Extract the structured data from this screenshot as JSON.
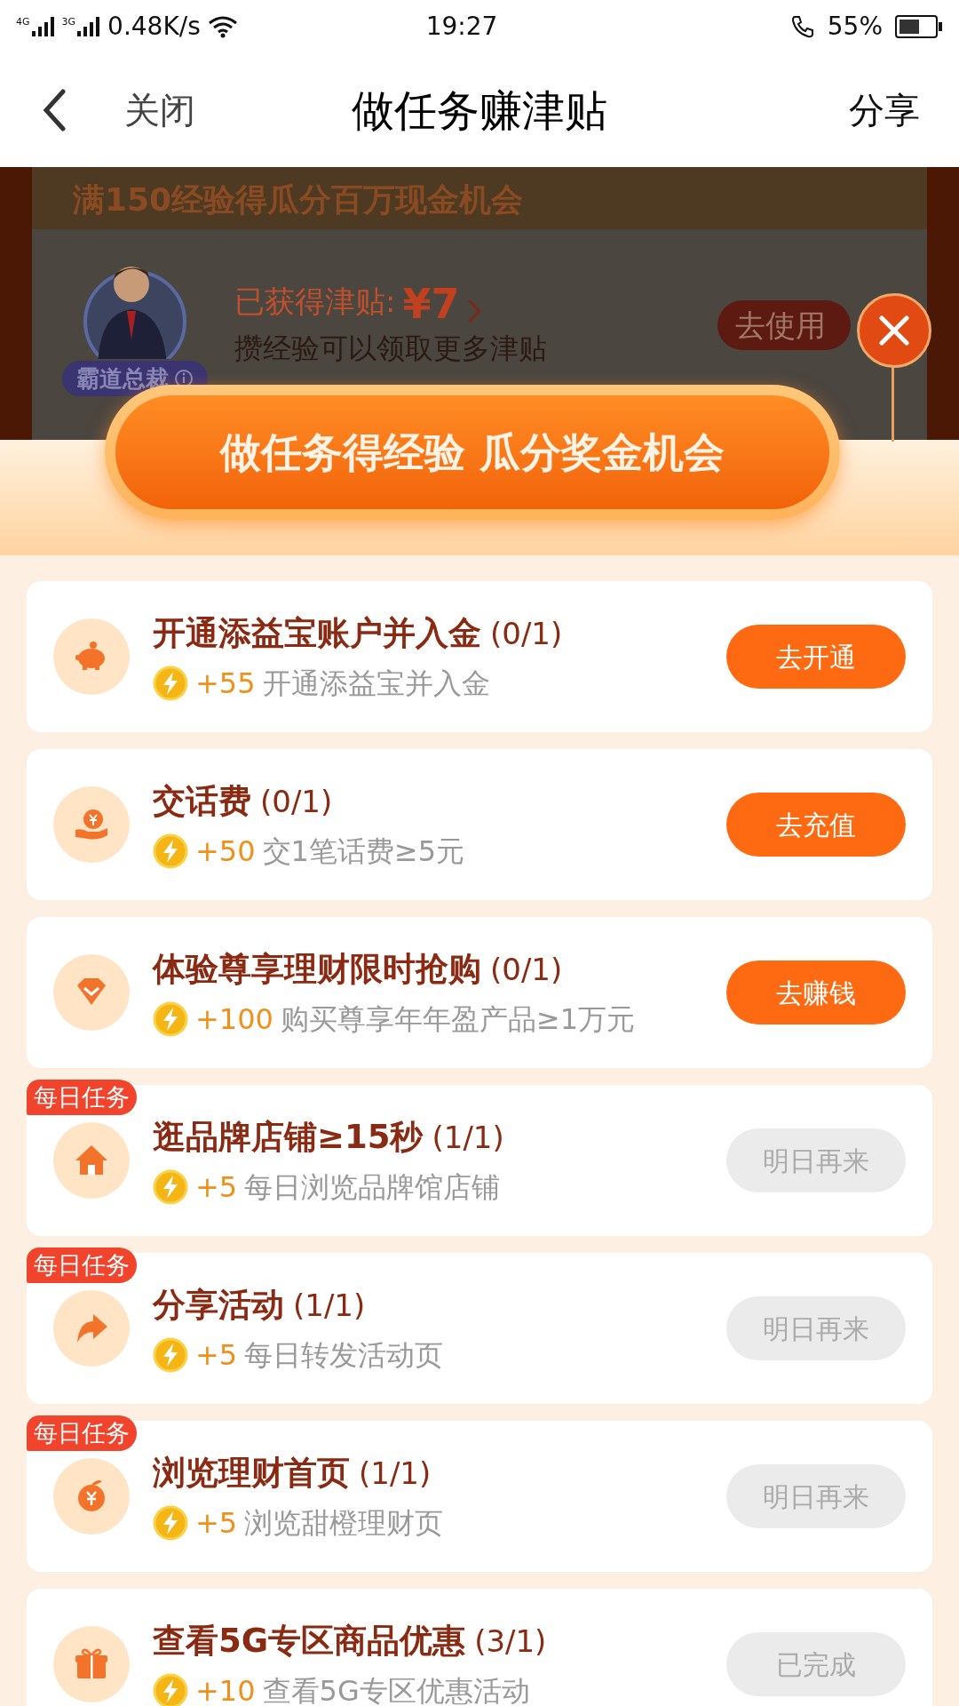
{
  "status_bar": {
    "network_1": "4G",
    "network_2": "3G",
    "speed": "0.48K/s",
    "time": "19:27",
    "battery": "55%"
  },
  "nav": {
    "close": "关闭",
    "title": "做任务赚津贴",
    "share": "分享"
  },
  "background_page": {
    "headline": "满150经验得瓜分百万现金机会",
    "avatar_badge": "霸道总裁",
    "earned_label": "已获得津贴:",
    "earned_amount": "¥7",
    "hint": "攒经验可以领取更多津贴",
    "use_button": "去使用"
  },
  "sheet": {
    "banner": "做任务得经验 瓜分奖金机会",
    "tasks": [
      {
        "kind": "piggy",
        "title": "开通添益宝账户并入金",
        "progress": "(0/1)",
        "points": "+55",
        "description": "开通添益宝并入金",
        "button": "去开通",
        "disabled": false
      },
      {
        "kind": "yen-hand",
        "title": "交话费",
        "progress": "(0/1)",
        "points": "+50",
        "description": "交1笔话费≥5元",
        "button": "去充值",
        "disabled": false
      },
      {
        "kind": "gem",
        "title": "体验尊享理财限时抢购",
        "progress": "(0/1)",
        "points": "+100",
        "description": "购买尊享年年盈产品≥1万元",
        "button": "去赚钱",
        "disabled": false
      },
      {
        "kind": "house",
        "daily_badge": "每日任务",
        "title": "逛品牌店铺≥15秒",
        "progress": "(1/1)",
        "points": "+5",
        "description": "每日浏览品牌馆店铺",
        "button": "明日再来",
        "disabled": true
      },
      {
        "kind": "share",
        "daily_badge": "每日任务",
        "title": "分享活动",
        "progress": "(1/1)",
        "points": "+5",
        "description": "每日转发活动页",
        "button": "明日再来",
        "disabled": true
      },
      {
        "kind": "orange",
        "daily_badge": "每日任务",
        "title": "浏览理财首页",
        "progress": "(1/1)",
        "points": "+5",
        "description": "浏览甜橙理财页",
        "button": "明日再来",
        "disabled": true
      },
      {
        "kind": "gift",
        "title": "查看5G专区商品优惠",
        "progress": "(3/1)",
        "points": "+10",
        "description": "查看5G专区优惠活动",
        "button": "已完成",
        "disabled": true
      }
    ]
  }
}
